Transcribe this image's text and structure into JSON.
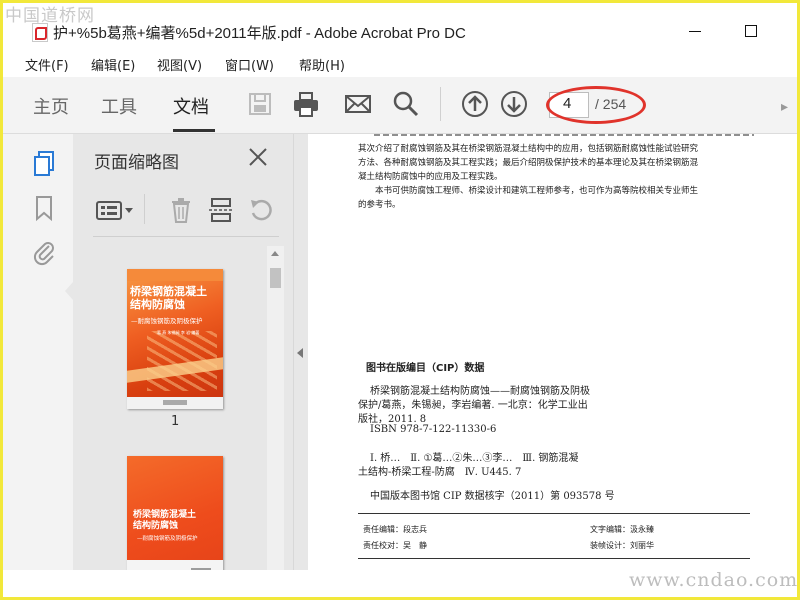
{
  "watermark": {
    "top_left": "中国道桥网",
    "bottom_right": "www.cndao.com"
  },
  "window": {
    "title": "护+%5b葛燕+编著%5d+2011年版.pdf - Adobe Acrobat Pro DC"
  },
  "menu": [
    "文件(F)",
    "编辑(E)",
    "视图(V)",
    "窗口(W)",
    "帮助(H)"
  ],
  "tabs": {
    "home": "主页",
    "tools": "工具",
    "document": "文档"
  },
  "pager": {
    "current_page": "4",
    "total": "/ 254"
  },
  "panel": {
    "title": "页面缩略图"
  },
  "thumbnails": [
    {
      "page_label": "1",
      "title_line1": "桥梁钢筋混凝土",
      "title_line2": "结构防腐蚀",
      "subtitle": "—耐腐蚀钢筋及阴极保护",
      "authors": "葛 燕  朱锡昶  李 岩  编著"
    },
    {
      "page_label": "",
      "title_line1": "桥梁钢筋混凝土",
      "title_line2": "结构防腐蚀",
      "subtitle": "—耐腐蚀钢筋及阴极保护",
      "authors": ""
    }
  ],
  "document": {
    "intro_lines": [
      "其次介绍了耐腐蚀钢筋及其在桥梁钢筋混凝土结构中的应用，包括钢筋耐腐蚀性能试验研究",
      "方法、各种耐腐蚀钢筋及其工程实践；最后介绍阴极保护技术的基本理论及其在桥梁钢筋混",
      "凝土结构防腐蚀中的应用及工程实践。",
      "　　本书可供防腐蚀工程师、桥梁设计和建筑工程师参考，也可作为高等院校相关专业师生",
      "的参考书。"
    ],
    "cip_heading": "图书在版编目（CIP）数据",
    "cip_lines": [
      "桥梁钢筋混凝土结构防腐蚀——耐腐蚀钢筋及阴极",
      "保护/葛燕，朱锡昶，李岩编著. 一北京：化学工业出",
      "版社，2011. 8",
      "ISBN 978-7-122-11330-6",
      "Ⅰ. 桥…　Ⅱ. ①葛…②朱…③李…　Ⅲ. 钢筋混凝",
      "土结构-桥梁工程-防腐　Ⅳ. U445. 7",
      "中国版本图书馆 CIP 数据核字（2011）第 093578 号"
    ],
    "credits": {
      "editor": "责任编辑：段志兵",
      "text_editor": "文字编辑：汲永臻",
      "proofreader": "责任校对：吴　静",
      "designer": "装帧设计：刘丽华"
    }
  },
  "colors": {
    "accent_red": "#e0332b",
    "cover_orange": "#ef5a1e",
    "frame_yellow": "#f2e83a"
  }
}
